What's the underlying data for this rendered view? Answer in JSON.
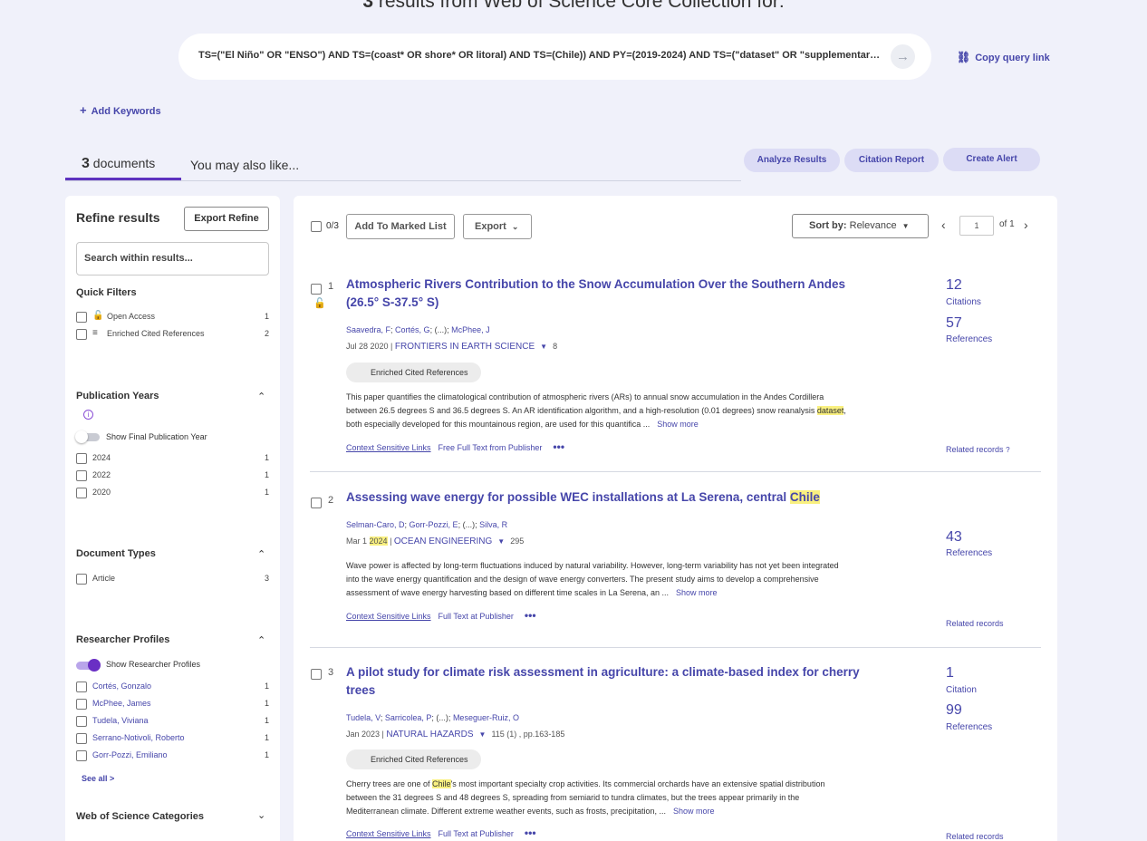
{
  "header": {
    "result_count": "3",
    "result_text": " results from Web of Science Core Collection for:",
    "query": "TS=(\"El Niño\" OR \"ENSO\") AND TS=(coast* OR shore* OR litoral) AND TS=(Chile)) AND PY=(2019-2024) AND TS=(\"dataset\" OR \"supplementary data\" OR \"repository\")",
    "copy_query_link": "Copy query link",
    "add_keywords": "Add Keywords"
  },
  "tabs": {
    "documents_count": "3",
    "documents_label": "documents",
    "also_like": "You may also like..."
  },
  "actions": {
    "analyze": "Analyze Results",
    "citation_report": "Citation Report",
    "create_alert": "Create Alert"
  },
  "sidebar": {
    "title": "Refine results",
    "export_refine": "Export Refine",
    "search_placeholder": "Search within results...",
    "quick_filters": {
      "title": "Quick Filters",
      "items": [
        {
          "label": "Open Access",
          "count": "1",
          "icon": "lock-open-icon"
        },
        {
          "label": "Enriched Cited References",
          "count": "2",
          "icon": "playlist-add-icon"
        }
      ]
    },
    "pub_years": {
      "title": "Publication Years",
      "toggle_label": "Show Final Publication Year",
      "items": [
        {
          "label": "2024",
          "count": "1"
        },
        {
          "label": "2022",
          "count": "1"
        },
        {
          "label": "2020",
          "count": "1"
        }
      ]
    },
    "doc_types": {
      "title": "Document Types",
      "items": [
        {
          "label": "Article",
          "count": "3"
        }
      ]
    },
    "researcher_profiles": {
      "title": "Researcher Profiles",
      "toggle_label": "Show Researcher Profiles",
      "items": [
        {
          "label": "Cortés, Gonzalo",
          "count": "1"
        },
        {
          "label": "McPhee, James",
          "count": "1"
        },
        {
          "label": "Tudela, Viviana",
          "count": "1"
        },
        {
          "label": "Serrano-Notivoli, Roberto",
          "count": "1"
        },
        {
          "label": "Gorr-Pozzi, Emiliano",
          "count": "1"
        }
      ],
      "see_all": "See all >"
    },
    "wos_categories": {
      "title": "Web of Science Categories"
    }
  },
  "toolbar": {
    "selected": "0/3",
    "add_to_marked": "Add To Marked List",
    "export": "Export",
    "sort_label": "Sort by:",
    "sort_value": "Relevance",
    "page": "1",
    "of": "of",
    "total_pages": "1"
  },
  "records": [
    {
      "num": "1",
      "title": "Atmospheric Rivers Contribution to the Snow Accumulation Over the Southern Andes (26.5° S-37.5° S)",
      "authors": [
        "Saavedra, F",
        "Cortés, G",
        "(...)",
        "McPhee, J"
      ],
      "date": "Jul 28 2020",
      "journal": "FRONTIERS IN EARTH SCIENCE",
      "extra": "8",
      "badge": "Enriched Cited References",
      "abstract_pre": "This paper quantifies the climatological contribution of atmospheric rivers (ARs) to annual snow accumulation in the Andes Cordillera between 26.5 degrees S and 36.5 degrees S. An AR identification algorithm, and a high-resolution (0.01 degrees) snow reanalysis ",
      "abstract_hl": "dataset",
      "abstract_post": ", both especially developed for this mountainous region, are used for this quantifica  ...",
      "show_more": "Show more",
      "csl": "Context Sensitive Links",
      "fulltext": "Free Full Text from Publisher",
      "citations_num": "12",
      "citations_lbl": "Citations",
      "refs_num": "57",
      "refs_lbl": "References",
      "related": "Related records"
    },
    {
      "num": "2",
      "title_pre": "Assessing wave energy for possible WEC installations at La Serena, central ",
      "title_hl": "Chile",
      "authors": [
        "Selman-Caro, D",
        "Gorr-Pozzi, E",
        "(...)",
        "Silva, R"
      ],
      "date": "Mar 1",
      "year_hl": "2024",
      "journal": "OCEAN ENGINEERING",
      "extra": "295",
      "abstract": "Wave power is affected by long-term fluctuations induced by natural variability. However, long-term variability has not yet been integrated into the wave energy quantification and the design of wave energy converters. The present study aims to develop a comprehensive assessment of wave energy harvesting based on different time scales in La Serena, an  ...",
      "show_more": "Show more",
      "csl": "Context Sensitive Links",
      "fulltext": "Full Text at Publisher",
      "refs_num": "43",
      "refs_lbl": "References",
      "related": "Related records"
    },
    {
      "num": "3",
      "title": "A pilot study for climate risk assessment in agriculture: a climate-based index for cherry trees",
      "authors": [
        "Tudela, V",
        "Sarricolea, P",
        "(...)",
        "Meseguer-Ruiz, O"
      ],
      "date": "Jan 2023",
      "journal": "NATURAL HAZARDS",
      "extra": "115 (1) , pp.163-185",
      "badge": "Enriched Cited References",
      "abstract_hl": "Chile",
      "abstract_post": "'s most important specialty crop activities. Its commercial orchards have an extensive spatial distribution between the 31 degrees S and 48 degrees S, spreading from semiarid to tundra climates, but the trees appear primarily in the Mediterranean climate. Different extreme weather events, such as frosts, precipitation,  ...",
      "abstract_pre": "Cherry trees are one of ",
      "show_more": "Show more",
      "csl": "Context Sensitive Links",
      "fulltext": "Full Text at Publisher",
      "citations_num": "1",
      "citations_lbl": "Citation",
      "refs_num": "99",
      "refs_lbl": "References",
      "related": "Related records"
    }
  ]
}
